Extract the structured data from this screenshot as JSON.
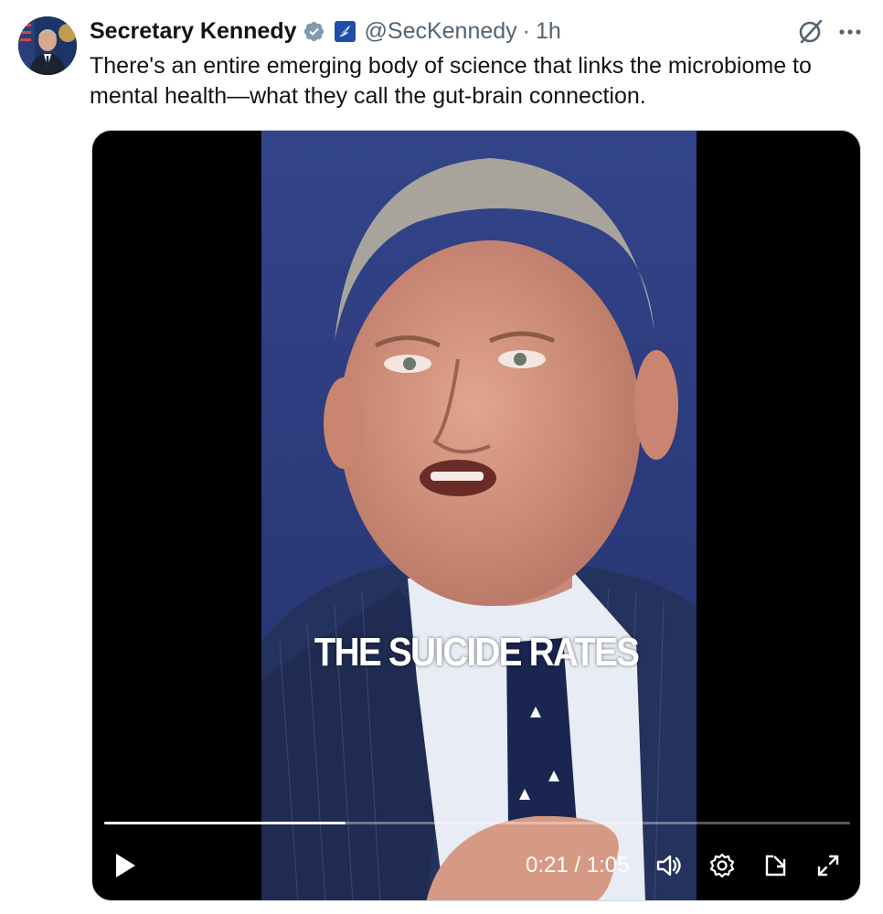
{
  "post": {
    "display_name": "Secretary Kennedy",
    "handle": "@SecKennedy",
    "separator": "·",
    "time": "1h",
    "text": "There's an entire emerging body of science that links the microbiome to mental health—what they call the gut-brain connection."
  },
  "video": {
    "caption": "THE SUICIDE RATES",
    "current_time": "0:21",
    "duration": "1:05",
    "time_display": "0:21 / 1:05",
    "progress_fraction": 0.323
  },
  "icons": {
    "verified": "verified-badge-icon",
    "affiliation": "gov-affiliation-icon",
    "grok": "grok-icon",
    "more": "more-icon",
    "play": "play-icon",
    "volume": "volume-icon",
    "settings": "settings-icon",
    "popout": "popout-icon",
    "fullscreen": "fullscreen-icon"
  },
  "colors": {
    "verified_badge": "#829aab",
    "secondary_text": "#536471",
    "backdrop": "#2d3f86"
  }
}
